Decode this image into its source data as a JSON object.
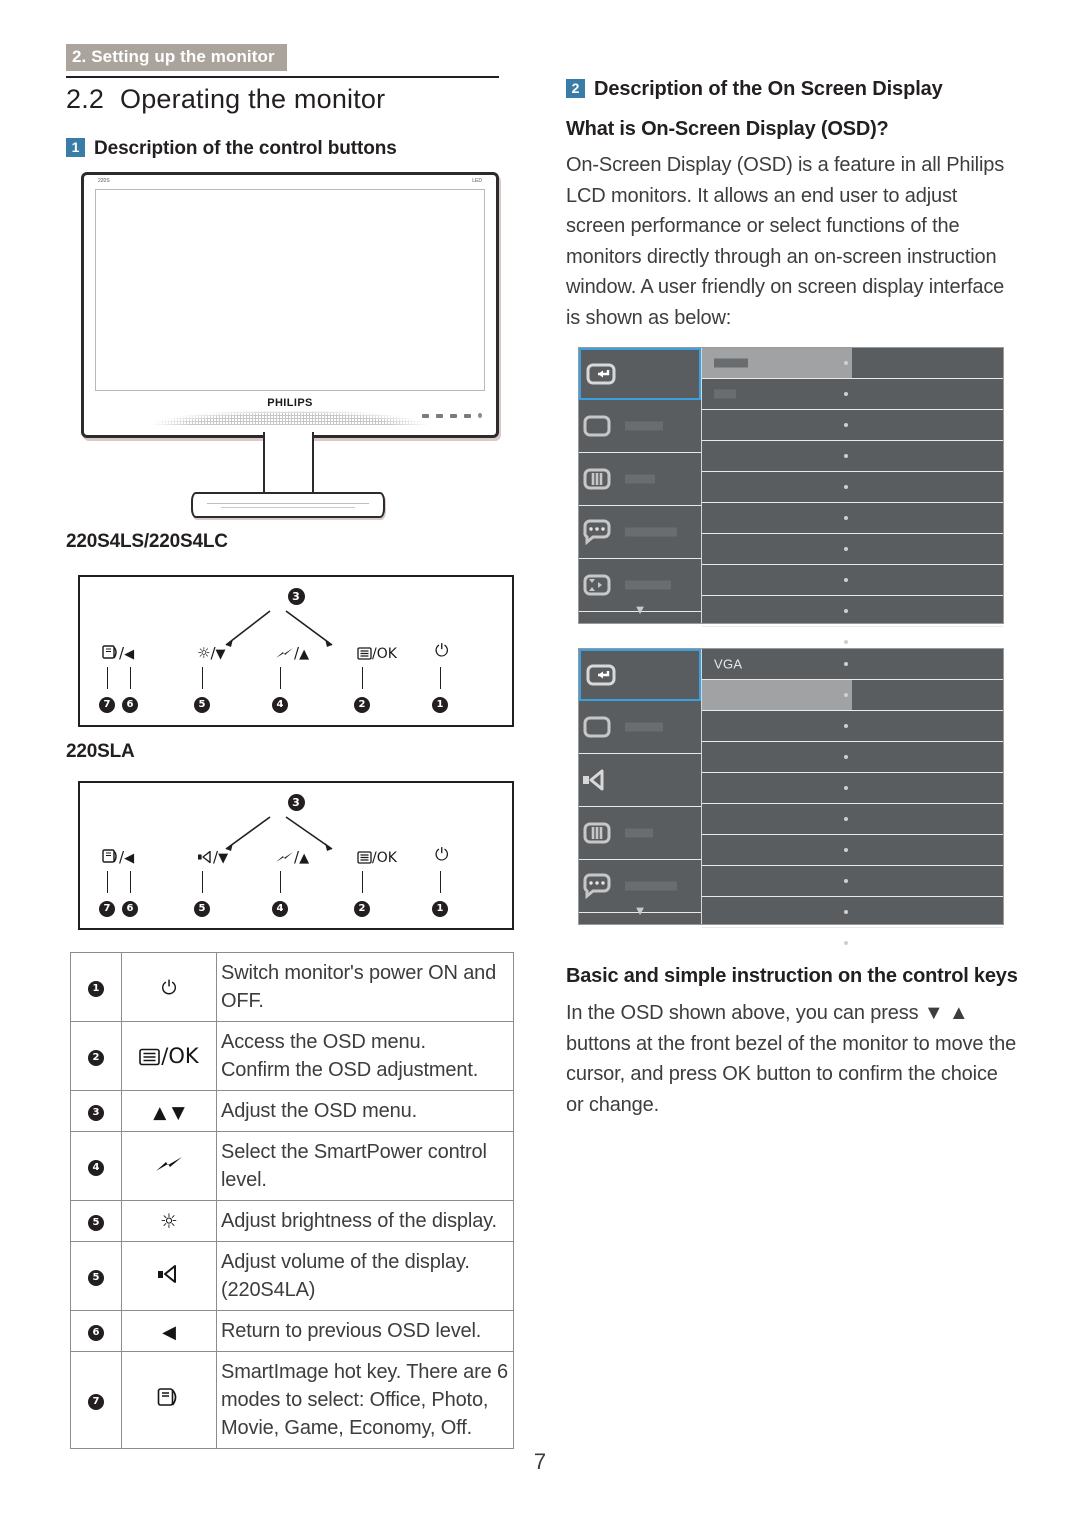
{
  "header": {
    "running_head": "2. Setting up the monitor"
  },
  "left_column": {
    "section_number": "2.2",
    "section_title": "Operating the monitor",
    "sub1_badge": "1",
    "sub1_title": "Description of the control buttons",
    "monitor_image": {
      "screen_tag_left": "220S",
      "screen_tag_right": "LED",
      "brand": "PHILIPS"
    },
    "model_label_1": "220S4LS/220S4LC",
    "model_label_2": "220SLA",
    "diagram1": {
      "top_callout": "3",
      "buttons": [
        {
          "symbol": "☰⃝/◀",
          "callouts": [
            "7",
            "6"
          ]
        },
        {
          "symbol": "☼/▼",
          "callouts": [
            "5"
          ]
        },
        {
          "symbol": "⚡/▲",
          "callouts": [
            "4"
          ]
        },
        {
          "symbol": "☰/OK",
          "callouts": [
            "2"
          ]
        },
        {
          "symbol": "⏻",
          "callouts": [
            "1"
          ]
        }
      ]
    },
    "diagram2": {
      "top_callout": "3",
      "buttons": [
        {
          "symbol": "☰⃝/◀",
          "callouts": [
            "7",
            "6"
          ]
        },
        {
          "symbol": "🔊/▼",
          "callouts": [
            "5"
          ]
        },
        {
          "symbol": "⚡/▲",
          "callouts": [
            "4"
          ]
        },
        {
          "symbol": "☰/OK",
          "callouts": [
            "2"
          ]
        },
        {
          "symbol": "⏻",
          "callouts": [
            "1"
          ]
        }
      ]
    },
    "key_table": {
      "rows": [
        {
          "no": "1",
          "icon": "power-icon",
          "glyph": "⏻",
          "text": "Switch monitor's power ON and OFF."
        },
        {
          "no": "2",
          "icon": "menu-ok-icon",
          "glyph": "⌸/OK",
          "text": "Access the OSD menu.\nConfirm the OSD adjustment."
        },
        {
          "no": "3",
          "icon": "up-down-icon",
          "glyph": "▲ ▼",
          "text": "Adjust the OSD menu."
        },
        {
          "no": "4",
          "icon": "smartpower-icon",
          "glyph": "⚡",
          "text": "Select the SmartPower control level."
        },
        {
          "no": "5",
          "icon": "brightness-icon",
          "glyph": "☼",
          "text": "Adjust brightness of the display."
        },
        {
          "no": "5",
          "icon": "volume-icon",
          "glyph": "🔊",
          "text": "Adjust volume of the display. (220S4LA)"
        },
        {
          "no": "6",
          "icon": "back-icon",
          "glyph": "◀",
          "text": "Return to previous OSD level."
        },
        {
          "no": "7",
          "icon": "smartimage-icon",
          "glyph": "❐",
          "text": "SmartImage hot key. There are 6 modes to select: Office, Photo, Movie, Game, Economy, Off."
        }
      ]
    }
  },
  "right_column": {
    "sub2_badge": "2",
    "sub2_title": "Description of the On Screen Display",
    "what_is_heading": "What is On-Screen Display (OSD)?",
    "what_is_body": "On-Screen Display (OSD) is a feature in all Philips LCD monitors. It allows an end user to adjust screen performance or select functions of the monitors directly through an on-screen instruction window. A user friendly on screen display interface is shown as below:",
    "osd1": {
      "sidebar_icons": [
        "input-return-icon",
        "picture-icon",
        "color-icon",
        "language-icon",
        "osd-settings-icon"
      ],
      "scroll_arrow": "▼",
      "rows": [
        {
          "label": "",
          "highlighted": true
        },
        {
          "label": "",
          "highlighted": false
        },
        {
          "label": "",
          "highlighted": false
        },
        {
          "label": "",
          "highlighted": false
        },
        {
          "label": "",
          "highlighted": false
        },
        {
          "label": "",
          "highlighted": false
        },
        {
          "label": "",
          "highlighted": false
        },
        {
          "label": "",
          "highlighted": false
        },
        {
          "label": "",
          "highlighted": false
        },
        {
          "label": "",
          "highlighted": false
        }
      ]
    },
    "osd2": {
      "sidebar_icons": [
        "input-return-icon",
        "picture-icon",
        "audio-icon",
        "color-icon",
        "language-icon"
      ],
      "scroll_arrow": "▼",
      "rows": [
        {
          "label": "VGA",
          "highlighted": false
        },
        {
          "label": "",
          "highlighted": true
        },
        {
          "label": "",
          "highlighted": false
        },
        {
          "label": "",
          "highlighted": false
        },
        {
          "label": "",
          "highlighted": false
        },
        {
          "label": "",
          "highlighted": false
        },
        {
          "label": "",
          "highlighted": false
        },
        {
          "label": "",
          "highlighted": false
        },
        {
          "label": "",
          "highlighted": false
        },
        {
          "label": "",
          "highlighted": false
        }
      ]
    },
    "basic_heading": "Basic and simple instruction on the control keys",
    "basic_body_1": "In the OSD shown above, you can press ▼ ▲ buttons at the front bezel of the monitor to move the cursor, and press ",
    "basic_body_ok": "OK",
    "basic_body_2": " button to confirm the choice or change."
  },
  "footer": {
    "page_number": "7"
  },
  "colors": {
    "runhead_bg": "#aaa49c",
    "badge_blue": "#3a7ca8",
    "osd_bg": "#5a5d60",
    "osd_highlight": "#a0a2a4",
    "osd_select_border": "#3aa0e0",
    "body_text": "#3d3d3d"
  }
}
